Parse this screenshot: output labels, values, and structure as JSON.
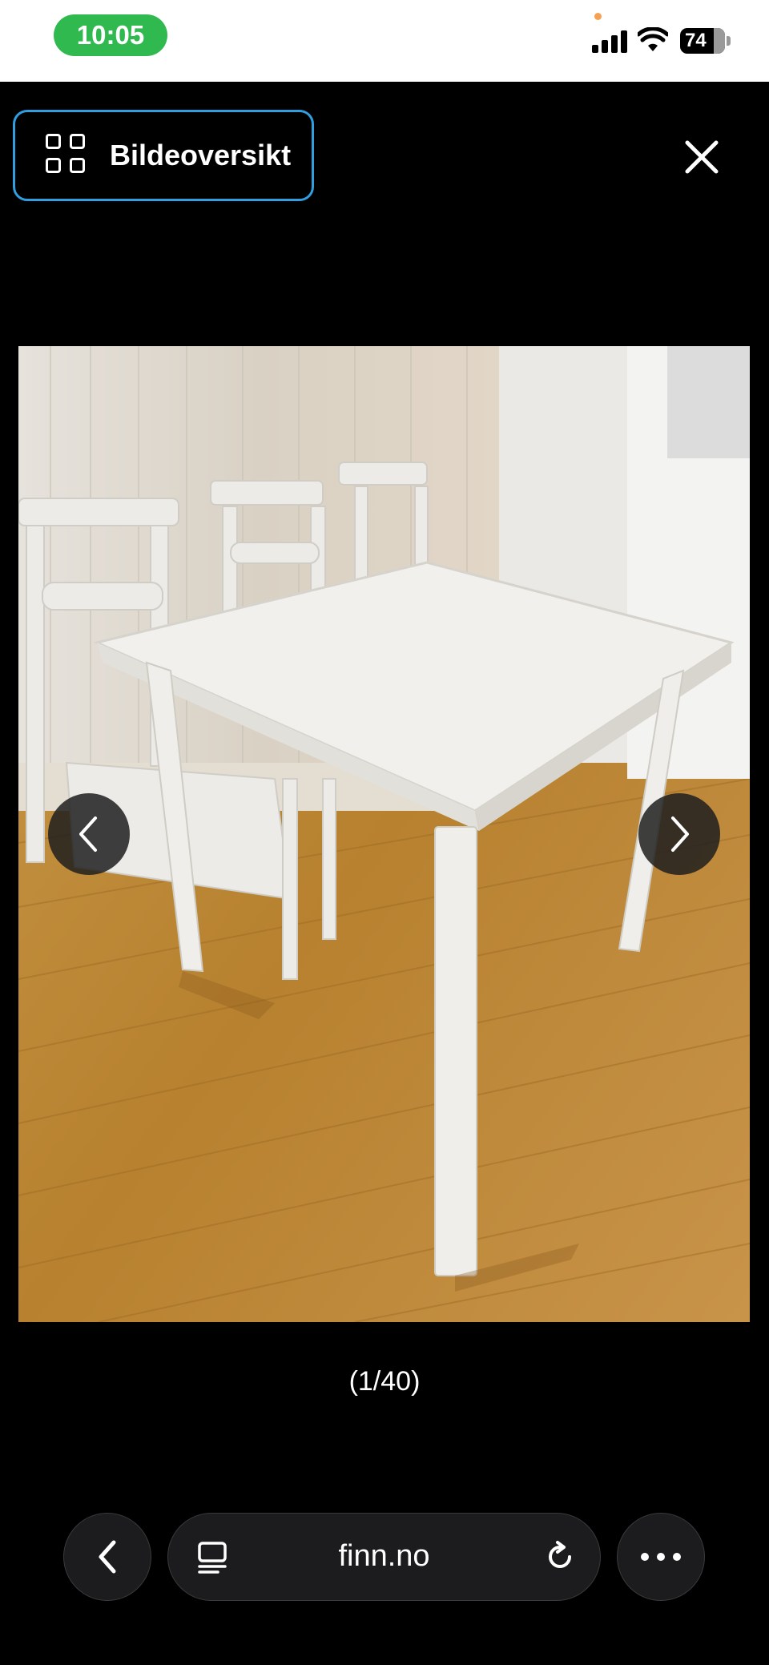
{
  "status_bar": {
    "time": "10:05",
    "battery": "74",
    "time_pill_color": "#30b94f"
  },
  "viewer": {
    "overview_label": "Bildeoversikt",
    "counter": "(1/40)",
    "accent_color": "#2f9fe0",
    "icons": [
      "grid-icon",
      "close-icon",
      "chevron-left-icon",
      "chevron-right-icon"
    ]
  },
  "browser": {
    "url": "finn.no",
    "icons": [
      "back-icon",
      "tab-icon",
      "reload-icon",
      "more-icon"
    ]
  }
}
